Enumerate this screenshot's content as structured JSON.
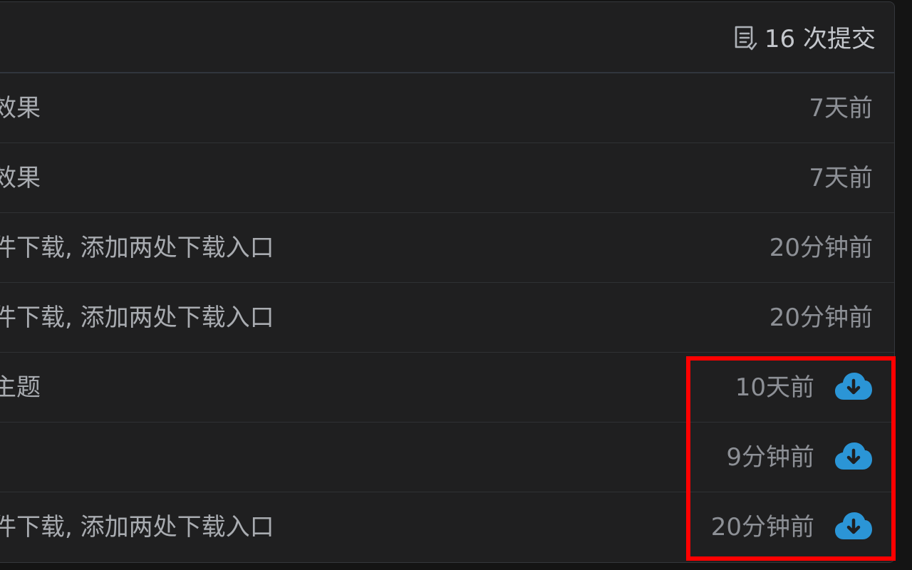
{
  "header": {
    "commit_count": "16 次提交",
    "icon": "commit-list-icon"
  },
  "rows": [
    {
      "message": "效果",
      "time": "7天前",
      "download": false
    },
    {
      "message": "效果",
      "time": "7天前",
      "download": false
    },
    {
      "message": "件下载, 添加两处下载入口",
      "time": "20分钟前",
      "download": false
    },
    {
      "message": "件下载, 添加两处下载入口",
      "time": "20分钟前",
      "download": false
    },
    {
      "message": "主题",
      "time": "10天前",
      "download": true
    },
    {
      "message": "",
      "time": "9分钟前",
      "download": true
    },
    {
      "message": "件下载, 添加两处下载入口",
      "time": "20分钟前",
      "download": true
    }
  ],
  "colors": {
    "download_icon": "#2b95d6",
    "highlight": "#ff0000"
  }
}
